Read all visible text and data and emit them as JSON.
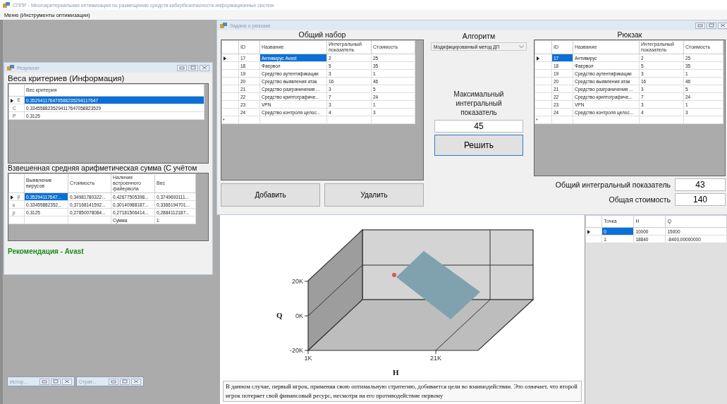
{
  "app": {
    "title": "СППР - Многокритериальная оптимизация по размещению средств кибербезопасности информационных систем",
    "menu": [
      "Меню (Инструменты оптимизации)"
    ]
  },
  "result_window": {
    "title": "Результат",
    "weights_heading": "Веса критериев (Информация)",
    "weights_table": {
      "columns": [
        "Вес критерия"
      ],
      "rows": [
        {
          "header": "Е",
          "cells": [
            {
              "text": "0.352941176470588235294117647",
              "selected": true
            }
          ]
        },
        {
          "header": "С",
          "cells": [
            {
              "text": "0.3345588235294117647058823529",
              "selected": false
            }
          ]
        },
        {
          "header": "Р",
          "cells": [
            {
              "text": "0.3125",
              "selected": false
            }
          ]
        }
      ]
    },
    "sum_heading": "Взвешенная средняя арифметическая сумма (С учётом",
    "sum_table": {
      "columns": [
        "Выявление вирусов",
        "Стоимость",
        "Наличие встроенного файервола",
        "Вес"
      ],
      "rows": [
        {
          "header": "р",
          "cells": [
            {
              "text": "0.35294117647...",
              "selected": true
            },
            {
              "text": "0,34981780322...",
              "selected": false
            },
            {
              "text": "0,42677505398...",
              "selected": false
            },
            {
              "text": "0,3749693111...",
              "selected": false
            }
          ]
        },
        {
          "header": "ь",
          "cells": [
            {
              "text": "0.33455882352...",
              "selected": false
            },
            {
              "text": "0,37168141592...",
              "selected": false
            },
            {
              "text": "0,30140988187...",
              "selected": false
            },
            {
              "text": "0,3366194701...",
              "selected": false
            }
          ]
        },
        {
          "header": "р",
          "cells": [
            {
              "text": "0.3125",
              "selected": false
            },
            {
              "text": "0,27850078084...",
              "selected": false
            },
            {
              "text": "0,27181506414...",
              "selected": false
            },
            {
              "text": "0,2884112187...",
              "selected": false
            }
          ]
        },
        {
          "header": "",
          "cells": [
            {
              "text": "",
              "selected": false
            },
            {
              "text": "",
              "selected": false
            },
            {
              "text": "Сумма",
              "selected": false
            },
            {
              "text": "1",
              "selected": false
            }
          ]
        }
      ]
    },
    "recommendation": "Рекомендация - Avast"
  },
  "knapsack_window": {
    "title": "Задача о рюкзаке",
    "all_items": {
      "heading": "Общий набор",
      "columns": [
        "ID",
        "Название",
        "Интегральный показатель",
        "Стоимость"
      ],
      "new_row_marker": "*",
      "rows": [
        {
          "cells": [
            {
              "text": "17",
              "selected": false
            },
            {
              "text": "Антивирус Avast",
              "selected": true
            },
            {
              "text": "2",
              "selected": false
            },
            {
              "text": "25",
              "selected": false
            }
          ]
        },
        {
          "cells": [
            {
              "text": "18",
              "selected": false
            },
            {
              "text": "Фаервол",
              "selected": false
            },
            {
              "text": "5",
              "selected": false
            },
            {
              "text": "35",
              "selected": false
            }
          ]
        },
        {
          "cells": [
            {
              "text": "19",
              "selected": false
            },
            {
              "text": "Средство аутентификации",
              "selected": false
            },
            {
              "text": "3",
              "selected": false
            },
            {
              "text": "1",
              "selected": false
            }
          ]
        },
        {
          "cells": [
            {
              "text": "20",
              "selected": false
            },
            {
              "text": "Средство выявления атак",
              "selected": false
            },
            {
              "text": "16",
              "selected": false
            },
            {
              "text": "46",
              "selected": false
            }
          ]
        },
        {
          "cells": [
            {
              "text": "21",
              "selected": false
            },
            {
              "text": "Средство разграничения ...",
              "selected": false
            },
            {
              "text": "3",
              "selected": false
            },
            {
              "text": "5",
              "selected": false
            }
          ]
        },
        {
          "cells": [
            {
              "text": "22",
              "selected": false
            },
            {
              "text": "Средство криптографиче...",
              "selected": false
            },
            {
              "text": "7",
              "selected": false
            },
            {
              "text": "24",
              "selected": false
            }
          ]
        },
        {
          "cells": [
            {
              "text": "23",
              "selected": false
            },
            {
              "text": "VPN",
              "selected": false
            },
            {
              "text": "3",
              "selected": false
            },
            {
              "text": "1",
              "selected": false
            }
          ]
        },
        {
          "cells": [
            {
              "text": "24",
              "selected": false
            },
            {
              "text": "Средство контроля целос...",
              "selected": false
            },
            {
              "text": "4",
              "selected": false
            },
            {
              "text": "3",
              "selected": false
            }
          ]
        }
      ]
    },
    "add_button": "Добавить",
    "delete_button": "Удалить",
    "algorithm_label": "Алгоритм",
    "algorithm_value": "Модифицированный метод ДП",
    "max_label": "Максимальный интегральный показатель",
    "max_value": "45",
    "solve_button": "Решить",
    "knapsack": {
      "heading": "Рюкзак",
      "columns": [
        "ID",
        "Название",
        "Интегральный показатель",
        "Стоимость"
      ],
      "new_row_marker": "*",
      "rows": [
        {
          "cells": [
            {
              "text": "17",
              "selected": true
            },
            {
              "text": "Антивирус",
              "selected": false
            },
            {
              "text": "2",
              "selected": false
            },
            {
              "text": "25",
              "selected": false
            }
          ]
        },
        {
          "cells": [
            {
              "text": "18",
              "selected": false
            },
            {
              "text": "Фаервол",
              "selected": false
            },
            {
              "text": "5",
              "selected": false
            },
            {
              "text": "35",
              "selected": false
            }
          ]
        },
        {
          "cells": [
            {
              "text": "19",
              "selected": false
            },
            {
              "text": "Средство аутентификации",
              "selected": false
            },
            {
              "text": "3",
              "selected": false
            },
            {
              "text": "1",
              "selected": false
            }
          ]
        },
        {
          "cells": [
            {
              "text": "20",
              "selected": false
            },
            {
              "text": "Средство выявления атак",
              "selected": false
            },
            {
              "text": "16",
              "selected": false
            },
            {
              "text": "46",
              "selected": false
            }
          ]
        },
        {
          "cells": [
            {
              "text": "21",
              "selected": false
            },
            {
              "text": "Средство разграничения ...",
              "selected": false
            },
            {
              "text": "3",
              "selected": false
            },
            {
              "text": "5",
              "selected": false
            }
          ]
        },
        {
          "cells": [
            {
              "text": "22",
              "selected": false
            },
            {
              "text": "Средство криптографиче...",
              "selected": false
            },
            {
              "text": "7",
              "selected": false
            },
            {
              "text": "24",
              "selected": false
            }
          ]
        },
        {
          "cells": [
            {
              "text": "23",
              "selected": false
            },
            {
              "text": "VPN",
              "selected": false
            },
            {
              "text": "3",
              "selected": false
            },
            {
              "text": "1",
              "selected": false
            }
          ]
        },
        {
          "cells": [
            {
              "text": "24",
              "selected": false
            },
            {
              "text": "Средство контроля целос...",
              "selected": false
            },
            {
              "text": "4",
              "selected": false
            },
            {
              "text": "3",
              "selected": false
            }
          ]
        }
      ]
    },
    "total_index_label": "Общий интегральный показатель",
    "total_index_value": "43",
    "total_cost_label": "Общая стоимость",
    "total_cost_value": "140"
  },
  "game_window": {
    "chart": {
      "xlabel": "H",
      "ylabel": "Q",
      "xticks": [
        "1K",
        "21K"
      ],
      "yticks": [
        "20K",
        "0K",
        "-20K"
      ]
    },
    "conclusion": "В данном случае, первый игрок, применяя свою оптимальную стратегию, добивается цели во взаимодействии. Это означает, что второй игрок потеряет свой финансовый ресурс, несмотря на его противодействие первому",
    "points_table": {
      "columns": [
        "Точка",
        "H",
        "Q"
      ],
      "rows": [
        {
          "cells": [
            {
              "text": "0",
              "selected": true
            },
            {
              "text": "10000",
              "selected": false
            },
            {
              "text": "15000",
              "selected": false
            }
          ]
        },
        {
          "cells": [
            {
              "text": "1",
              "selected": false
            },
            {
              "text": "18840",
              "selected": false
            },
            {
              "text": "-8400,00000000",
              "selected": false
            }
          ]
        }
      ]
    }
  },
  "minimized_windows": [
    {
      "title": "Истор..."
    },
    {
      "title": "Страт..."
    }
  ]
}
